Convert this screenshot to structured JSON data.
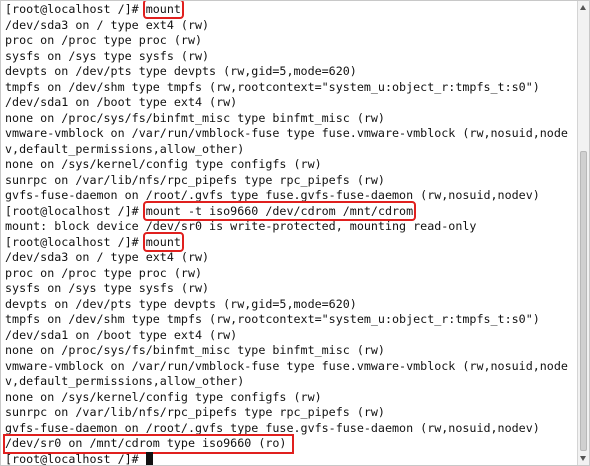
{
  "terminal": {
    "prompt": "[root@localhost /]# ",
    "lines": [
      {
        "type": "cmd",
        "text": "mount"
      },
      {
        "type": "out",
        "text": "/dev/sda3 on / type ext4 (rw)"
      },
      {
        "type": "out",
        "text": "proc on /proc type proc (rw)"
      },
      {
        "type": "out",
        "text": "sysfs on /sys type sysfs (rw)"
      },
      {
        "type": "out",
        "text": "devpts on /dev/pts type devpts (rw,gid=5,mode=620)"
      },
      {
        "type": "out",
        "text": "tmpfs on /dev/shm type tmpfs (rw,rootcontext=\"system_u:object_r:tmpfs_t:s0\")"
      },
      {
        "type": "out",
        "text": "/dev/sda1 on /boot type ext4 (rw)"
      },
      {
        "type": "out",
        "text": "none on /proc/sys/fs/binfmt_misc type binfmt_misc (rw)"
      },
      {
        "type": "out",
        "text": "vmware-vmblock on /var/run/vmblock-fuse type fuse.vmware-vmblock (rw,nosuid,node"
      },
      {
        "type": "out",
        "text": "v,default_permissions,allow_other)"
      },
      {
        "type": "out",
        "text": "none on /sys/kernel/config type configfs (rw)"
      },
      {
        "type": "out",
        "text": "sunrpc on /var/lib/nfs/rpc_pipefs type rpc_pipefs (rw)"
      },
      {
        "type": "out",
        "text": "gvfs-fuse-daemon on /root/.gvfs type fuse.gvfs-fuse-daemon (rw,nosuid,nodev)"
      },
      {
        "type": "cmd",
        "text": "mount -t iso9660 /dev/cdrom /mnt/cdrom"
      },
      {
        "type": "out",
        "text": "mount: block device /dev/sr0 is write-protected, mounting read-only"
      },
      {
        "type": "cmd",
        "text": "mount"
      },
      {
        "type": "out",
        "text": "/dev/sda3 on / type ext4 (rw)"
      },
      {
        "type": "out",
        "text": "proc on /proc type proc (rw)"
      },
      {
        "type": "out",
        "text": "sysfs on /sys type sysfs (rw)"
      },
      {
        "type": "out",
        "text": "devpts on /dev/pts type devpts (rw,gid=5,mode=620)"
      },
      {
        "type": "out",
        "text": "tmpfs on /dev/shm type tmpfs (rw,rootcontext=\"system_u:object_r:tmpfs_t:s0\")"
      },
      {
        "type": "out",
        "text": "/dev/sda1 on /boot type ext4 (rw)"
      },
      {
        "type": "out",
        "text": "none on /proc/sys/fs/binfmt_misc type binfmt_misc (rw)"
      },
      {
        "type": "out",
        "text": "vmware-vmblock on /var/run/vmblock-fuse type fuse.vmware-vmblock (rw,nosuid,node"
      },
      {
        "type": "out",
        "text": "v,default_permissions,allow_other)"
      },
      {
        "type": "out",
        "text": "none on /sys/kernel/config type configfs (rw)"
      },
      {
        "type": "out",
        "text": "sunrpc on /var/lib/nfs/rpc_pipefs type rpc_pipefs (rw)"
      },
      {
        "type": "out",
        "text": "gvfs-fuse-daemon on /root/.gvfs type fuse.gvfs-fuse-daemon (rw,nosuid,nodev)"
      },
      {
        "type": "out-hl",
        "text": "/dev/sr0 on /mnt/cdrom type iso9660 (ro)"
      },
      {
        "type": "prompt-cursor",
        "text": ""
      }
    ]
  },
  "colors": {
    "background": "#ffffff",
    "text": "#111111",
    "highlight_box": "#e0201e"
  }
}
